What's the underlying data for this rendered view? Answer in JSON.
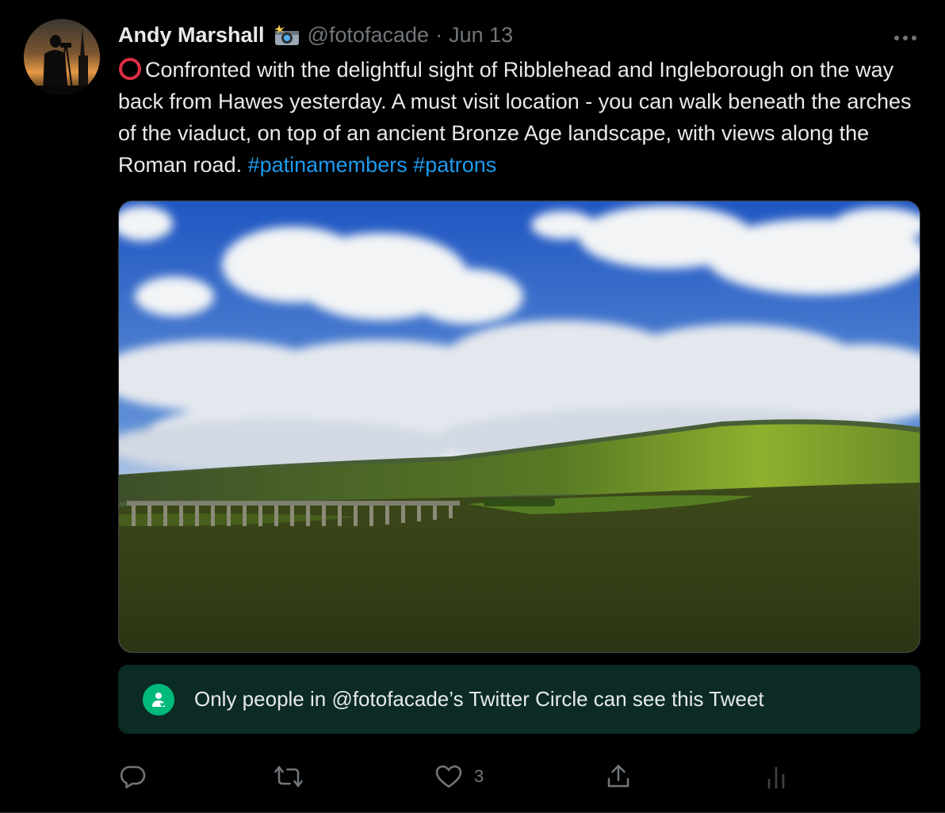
{
  "tweet": {
    "author": {
      "display_name": "Andy Marshall",
      "badge_icon": "camera-flash-icon",
      "handle": "@fotofacade",
      "separator": "·",
      "date": "Jun 13"
    },
    "body": {
      "prefix_icon": "red-circle-icon",
      "text": "Confronted with the delightful sight of Ribblehead and Ingleborough on the way back from Hawes yesterday. A must visit location - you can walk beneath the arches of the viaduct, on top of an ancient Bronze Age landscape, with views along the Roman road. ",
      "hashtags": [
        "#patinamembers",
        "#patrons"
      ]
    },
    "media": {
      "icon": "landscape-photo"
    },
    "circle_notice": {
      "icon": "twitter-circle-icon",
      "text": "Only people in @fotofacade’s Twitter Circle can see this Tweet"
    },
    "actions": {
      "reply_icon": "reply-icon",
      "retweet_icon": "retweet-icon",
      "like_icon": "heart-icon",
      "like_count": "3",
      "share_icon": "share-icon",
      "analytics_icon": "analytics-icon"
    },
    "more_icon": "more-options-icon"
  },
  "colors": {
    "background": "#000000",
    "text_primary": "#e7e9ea",
    "text_secondary": "#71767b",
    "link": "#1d9bf0",
    "circle_banner_bg": "#0b2b24",
    "circle_icon": "#00ba7c",
    "emoji_red": "#dd2e44"
  }
}
